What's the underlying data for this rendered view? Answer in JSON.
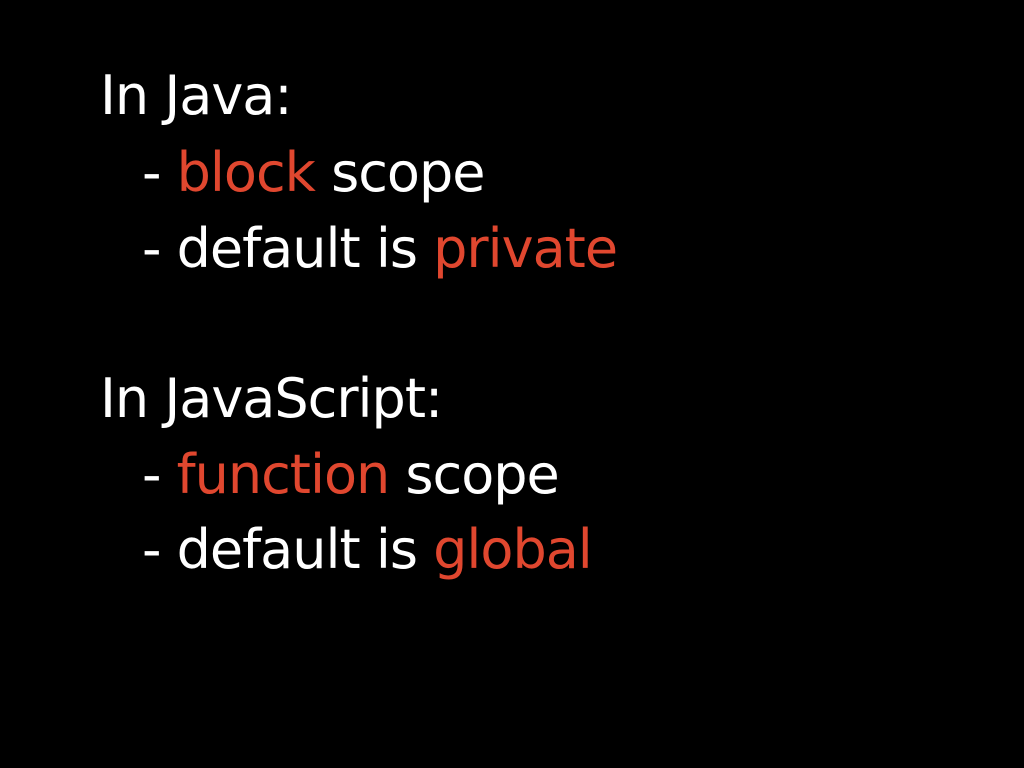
{
  "colors": {
    "background": "#000000",
    "text": "#ffffff",
    "highlight": "#e0472f"
  },
  "java": {
    "heading": "In Java:",
    "bullet1": {
      "dash": "- ",
      "keyword": "block",
      "rest": " scope"
    },
    "bullet2": {
      "dash": "- ",
      "prefix": "default is ",
      "keyword": "private"
    }
  },
  "javascript": {
    "heading": "In JavaScript:",
    "bullet1": {
      "dash": "- ",
      "keyword": "function",
      "rest": " scope"
    },
    "bullet2": {
      "dash": "- ",
      "prefix": "default is ",
      "keyword": "global"
    }
  }
}
